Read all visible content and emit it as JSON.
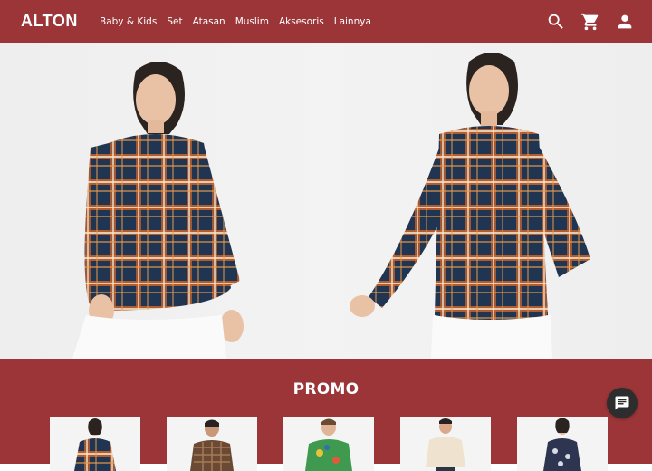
{
  "header": {
    "logo": "ALTON",
    "nav": [
      {
        "label": "Baby & Kids"
      },
      {
        "label": "Set"
      },
      {
        "label": "Atasan"
      },
      {
        "label": "Muslim"
      },
      {
        "label": "Aksesoris"
      },
      {
        "label": "Lainnya"
      }
    ],
    "icons": [
      "search-icon",
      "cart-icon",
      "account-icon"
    ]
  },
  "hero": {
    "image": "two models wearing navy and orange plaid flannel shirts"
  },
  "promo": {
    "title": "PROMO",
    "products": [
      {
        "image": "woman in plaid flannel shirt"
      },
      {
        "image": "man in brown plaid shirt"
      },
      {
        "image": "man in tropical print shirt"
      },
      {
        "image": "man in cream short-sleeve shirt"
      },
      {
        "image": "woman in navy floral blouse"
      }
    ]
  },
  "chat": {
    "icon": "chat-icon"
  },
  "colors": {
    "brand": "#9b3538",
    "hero_background": "#f0f0f0",
    "chat_button": "#2d2d2d"
  }
}
